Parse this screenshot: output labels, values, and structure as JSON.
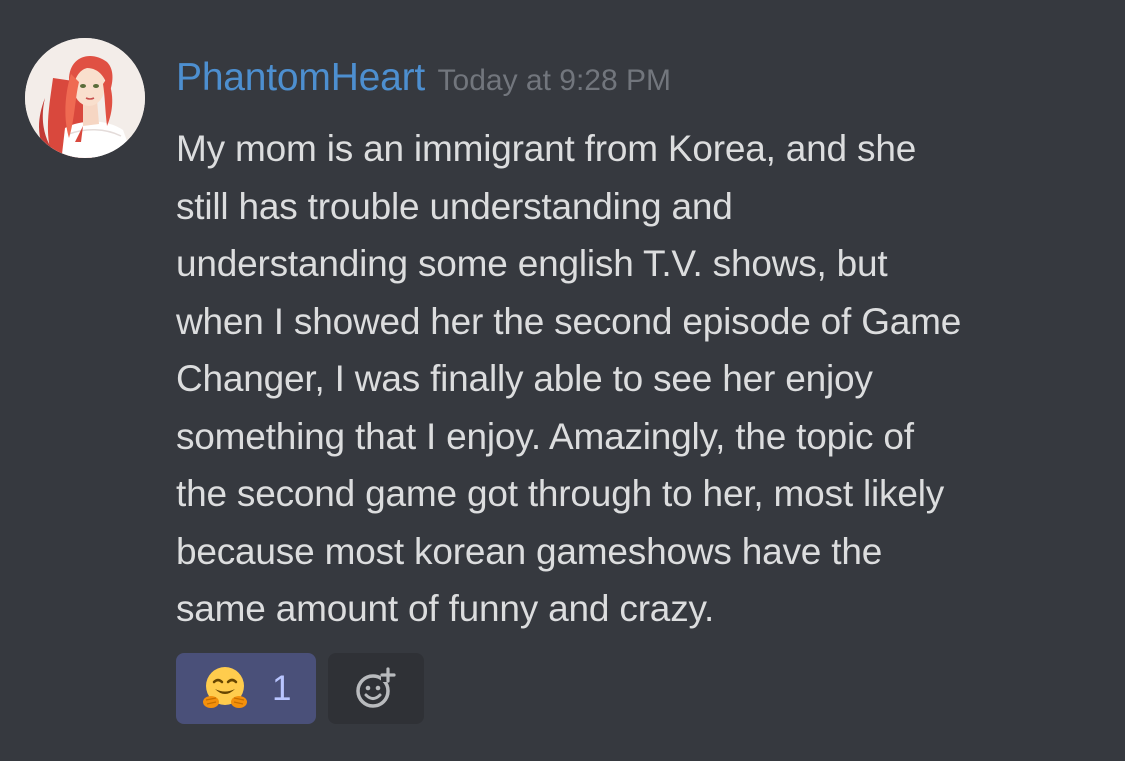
{
  "message": {
    "username": "PhantomHeart",
    "timestamp": "Today at 9:28 PM",
    "content_lines": [
      "My mom is an immigrant from Korea, and she",
      "still has trouble understanding and",
      "understanding some english T.V. shows, but",
      "when I showed her the second episode of Game",
      "Changer, I was finally able to see her enjoy",
      "something that I enjoy. Amazingly, the topic of",
      "the second game got through to her, most likely",
      "because most korean gameshows have the",
      "same amount of funny and crazy."
    ]
  },
  "reactions": [
    {
      "emoji": "hugging-face-emoji",
      "count": "1"
    }
  ],
  "add_reaction": {
    "icon": "add-reaction-icon"
  },
  "colors": {
    "background": "#36393f",
    "username": "#4d8fd0",
    "timestamp": "#72767d",
    "text": "#dcddde",
    "reaction_bg": "#4a5079",
    "reaction_count": "#b9c5ff",
    "add_reaction_bg": "#2f3136"
  }
}
